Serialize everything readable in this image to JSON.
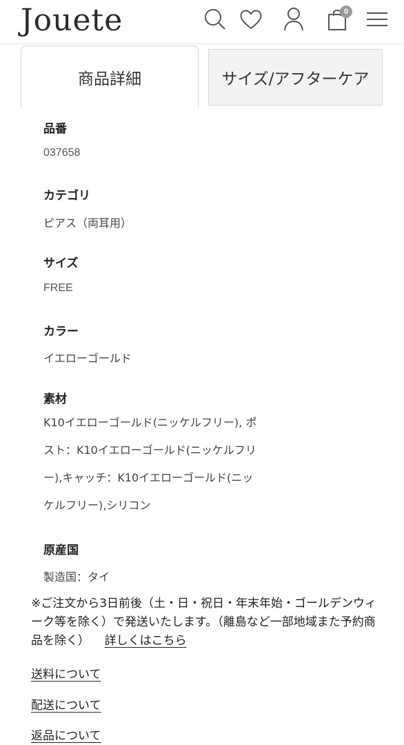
{
  "header": {
    "logo": "Jouete",
    "cart_count": "0",
    "icons": [
      "search-icon",
      "heart-icon",
      "user-icon",
      "cart-icon",
      "menu-icon"
    ]
  },
  "tabs": [
    {
      "label": "商品詳細",
      "active": true
    },
    {
      "label": "サイズ/アフターケア",
      "active": false
    }
  ],
  "specs": {
    "product_number_label": "品番",
    "product_number": "037658",
    "category_label": "カテゴリ",
    "category": "ピアス（両耳用）",
    "size_label": "サイズ",
    "size": "FREE",
    "color_label": "カラー",
    "color": "イエローゴールド",
    "material_label": "素材",
    "material_lines": [
      "K10イエローゴールド(ニッケルフリー), ポ",
      "スト：K10イエローゴールド(ニッケルフリ",
      "ー),キャッチ：K10イエローゴールド(ニッ",
      "ケルフリー),シリコン"
    ],
    "origin_label": "原産国",
    "origin": "製造国：タイ"
  },
  "notice": {
    "text": "※ご注文から3日前後（土・日・祝日・年末年始・ゴールデンウィーク等を除く）で発送いたします。（離島など一部地域また予約商品を除く）",
    "link_label": "詳しくはこちら"
  },
  "links": {
    "shipping_fee": "送料について",
    "delivery": "配送について",
    "returns": "返品について"
  }
}
